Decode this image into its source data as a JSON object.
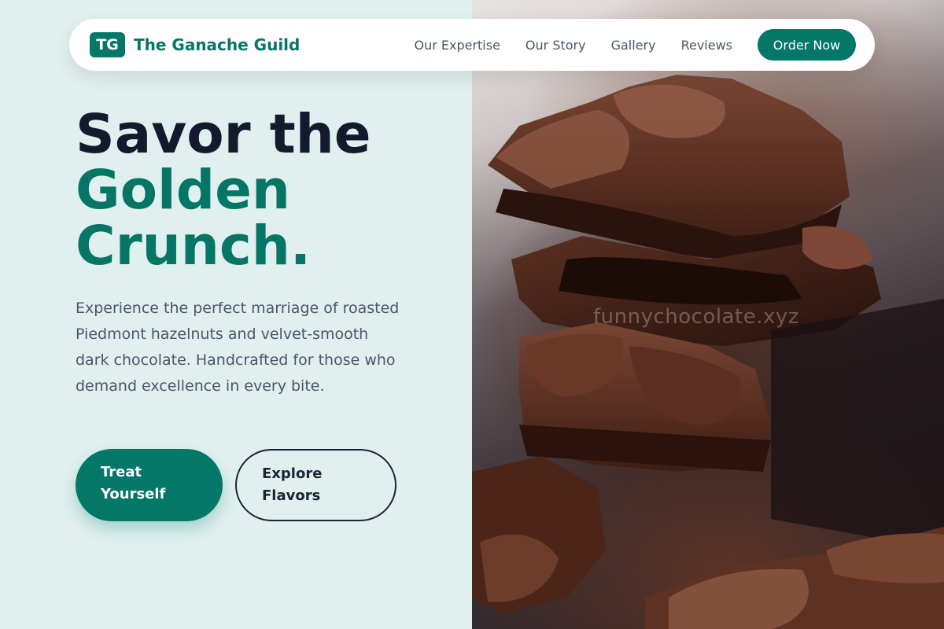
{
  "brand": {
    "mark": "TG",
    "name": "The Ganache Guild"
  },
  "nav": {
    "links": [
      "Our Expertise",
      "Our Story",
      "Gallery",
      "Reviews"
    ],
    "cta": "Order Now"
  },
  "hero": {
    "line1": "Savor the",
    "line2": "Golden",
    "line3": "Crunch.",
    "description": "Experience the perfect marriage of roasted Piedmont hazelnuts and velvet-smooth dark chocolate. Handcrafted for those who demand excellence in every bite.",
    "primary_button": "Treat Yourself",
    "secondary_button": "Explore Flavors"
  },
  "image": {
    "watermark": "funnychocolate.xyz"
  },
  "colors": {
    "accent": "#037768",
    "heading_dark": "#131a2e",
    "background": "#dff0ee",
    "body_text": "#4b5669"
  }
}
